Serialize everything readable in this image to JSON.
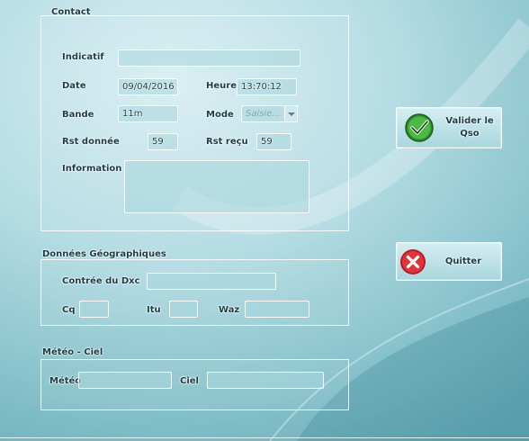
{
  "contact": {
    "legend": "Contact",
    "indicatif_label": "Indicatif",
    "indicatif_value": "",
    "date_label": "Date",
    "date_value": "09/04/2016",
    "heure_label": "Heure",
    "heure_value": "13:70:12",
    "bande_label": "Bande",
    "bande_value": "11m",
    "mode_label": "Mode",
    "mode_placeholder": "Saisie...",
    "rst_donne_label": "Rst donnée",
    "rst_donne_value": "59",
    "rst_recu_label": "Rst reçu",
    "rst_recu_value": "59",
    "information_label": "Information",
    "information_value": ""
  },
  "geo": {
    "legend": "Données Géographiques",
    "contree_label": "Contrée du Dxc",
    "cq_label": "Cq",
    "itu_label": "Itu",
    "waz_label": "Waz"
  },
  "meteo": {
    "legend": "Météo - Ciel",
    "meteo_label": "Météo",
    "ciel_label": "Ciel"
  },
  "actions": {
    "validate_label": "Valider le Qso",
    "quit_label": "Quitter"
  },
  "colors": {
    "validate_icon": "#3fa83a",
    "quit_icon": "#d8262b"
  },
  "icons": {
    "validate": "checkmark-icon",
    "quit": "close-icon"
  }
}
